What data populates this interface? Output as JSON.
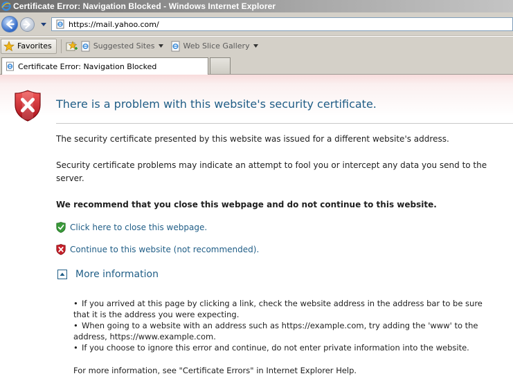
{
  "window": {
    "title": "Certificate Error: Navigation Blocked - Windows Internet Explorer"
  },
  "address_bar": {
    "url": "https://mail.yahoo.com/"
  },
  "favorites_bar": {
    "favorites_label": "Favorites",
    "links": [
      {
        "label": "Suggested Sites",
        "icon": "ie-page-icon"
      },
      {
        "label": "Web Slice Gallery",
        "icon": "ie-page-icon"
      }
    ]
  },
  "tabs": [
    {
      "label": "Certificate Error: Navigation Blocked",
      "active": true
    },
    {
      "label": "",
      "active": false
    }
  ],
  "page": {
    "heading": "There is a problem with this website's security certificate.",
    "paragraph_1": "The security certificate presented by this website was issued for a different website's address.",
    "paragraph_2_line_1": "Security certificate problems may indicate an attempt to fool you or intercept any data you send to the",
    "paragraph_2_line_2": "server.",
    "recommendation": "We recommend that you close this webpage and do not continue to this website.",
    "close_link": "Click here to close this webpage.",
    "continue_link": "Continue to this website (not recommended).",
    "more_info_label": "More information",
    "bullets": [
      {
        "line_1": "If you arrived at this page by clicking a link, check the website address in the address bar to be sure",
        "line_2": "that it is the address you were expecting."
      },
      {
        "line_1": "When going to a website with an address such as https://example.com, try adding the 'www' to the",
        "line_2": "address, https://www.example.com."
      },
      {
        "line_1": "If you choose to ignore this error and continue, do not enter private information into the website."
      }
    ],
    "footer": "For more information, see \"Certificate Errors\" in Internet Explorer Help."
  },
  "colors": {
    "link_blue": "#1f5d86",
    "shield_red": "#c8202a",
    "shield_green": "#3a9a3a",
    "chrome_gray": "#d4d0c8"
  }
}
